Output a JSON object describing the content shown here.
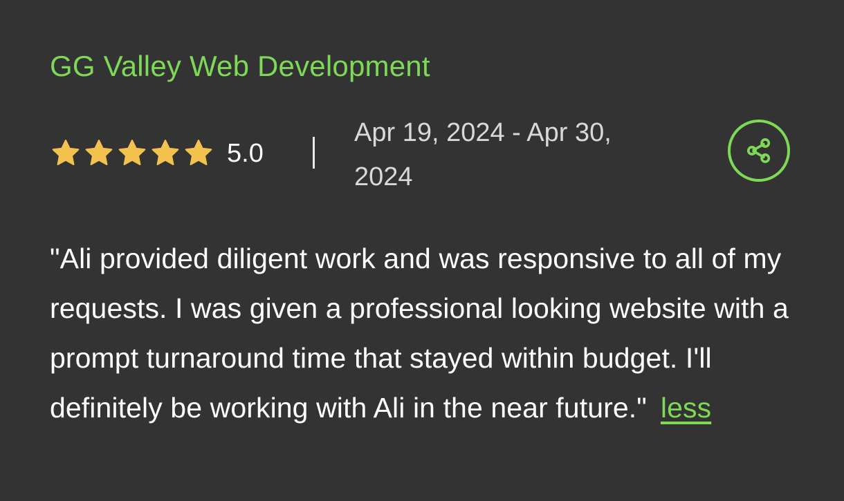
{
  "review": {
    "company": "GG Valley Web Development",
    "rating_value": 5,
    "rating_max": 5,
    "score_label": "5.0",
    "date_range": "Apr 19, 2024 - Apr 30, 2024",
    "text": "\"Ali provided diligent work and was responsive to all of my requests. I was given a professional looking website with a prompt turnaround time that stayed within budget. I'll definitely be working with Ali in the near future.\"",
    "less_label": "less"
  },
  "icons": {
    "star": "star-icon",
    "share": "share-icon"
  },
  "colors": {
    "background": "#333333",
    "accent_green": "#7ed957",
    "star_gold": "#f2c14e",
    "text_primary": "#ffffff",
    "text_secondary": "#d9d9d9"
  }
}
